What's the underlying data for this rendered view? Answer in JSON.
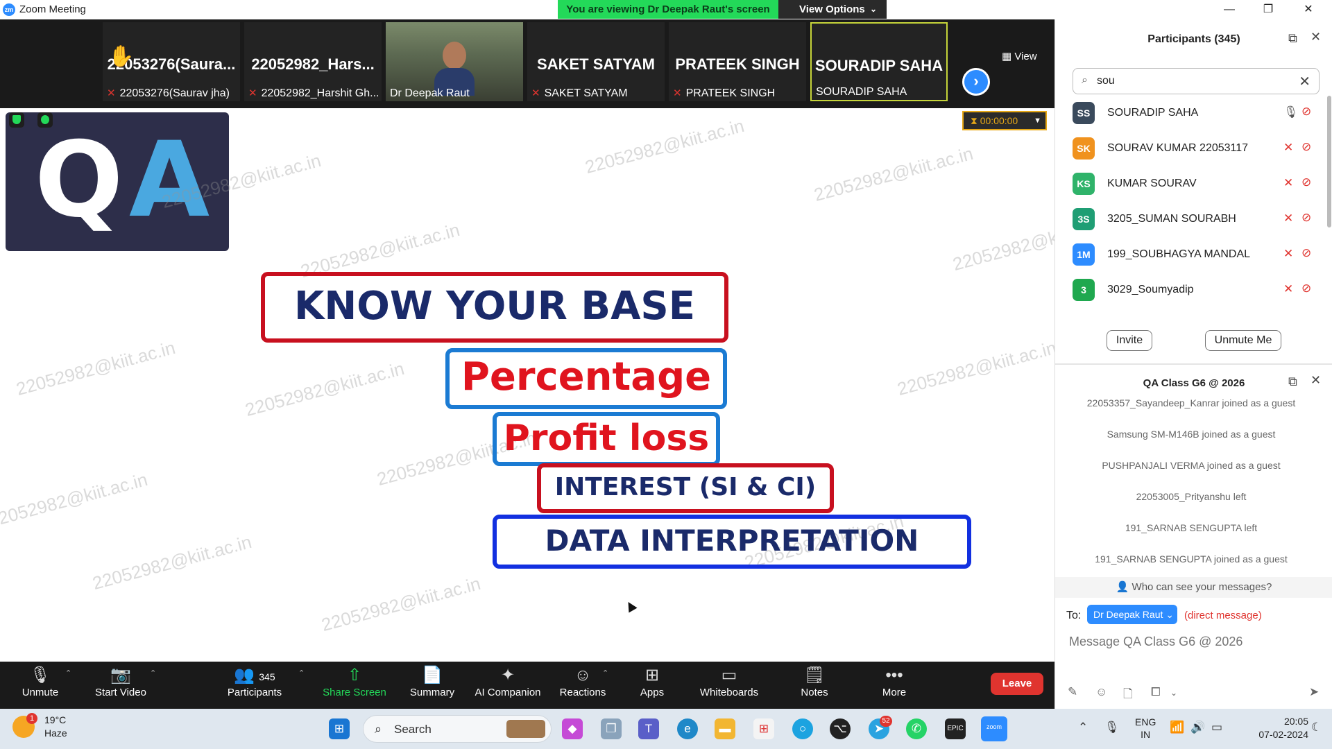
{
  "window": {
    "title": "Zoom Meeting",
    "banner_text": "You are viewing Dr Deepak Raut's screen",
    "view_options_label": "View Options",
    "minimize": "—",
    "maximize": "❐",
    "close": "✕"
  },
  "gallery": {
    "tiles": [
      {
        "big": "22053276(Saura...",
        "name": "22053276(Saurav jha)",
        "muted": true,
        "hand": true
      },
      {
        "big": "22052982_Hars...",
        "name": "22052982_Harshit Gh...",
        "muted": true
      },
      {
        "big": "",
        "name": "Dr Deepak Raut",
        "muted": false,
        "video": true
      },
      {
        "big": "SAKET SATYAM",
        "name": "SAKET SATYAM",
        "muted": true
      },
      {
        "big": "PRATEEK SINGH",
        "name": "PRATEEK SINGH",
        "muted": true
      },
      {
        "big": "SOURADIP SAHA",
        "name": "SOURADIP SAHA",
        "muted": false,
        "active": true
      }
    ],
    "view_label": "View"
  },
  "shared_screen": {
    "logo_q": "Q",
    "logo_a": "A",
    "timer": "00:00:00",
    "slide": {
      "line1": "KNOW YOUR BASE",
      "line2": "Percentage",
      "line3": "Profit loss",
      "line4": "INTEREST (SI & CI)",
      "line5": "DATA INTERPRETATION"
    },
    "watermark": "22052982@kiit.ac.in"
  },
  "toolbar": {
    "unmute": "Unmute",
    "start_video": "Start Video",
    "participants": "Participants",
    "participants_count": "345",
    "share_screen": "Share Screen",
    "summary": "Summary",
    "ai_companion": "AI Companion",
    "reactions": "Reactions",
    "apps": "Apps",
    "whiteboards": "Whiteboards",
    "notes": "Notes",
    "more": "More",
    "leave": "Leave"
  },
  "participants_panel": {
    "title": "Participants (345)",
    "search_value": "sou",
    "rows": [
      {
        "initials": "SS",
        "name": "SOURADIP SAHA",
        "color": "#3a4a5c",
        "mic_on": true
      },
      {
        "initials": "SK",
        "name": "SOURAV KUMAR 22053117",
        "color": "#f0921e",
        "mic_on": false
      },
      {
        "initials": "KS",
        "name": "KUMAR SOURAV",
        "color": "#2fb36a",
        "mic_on": false
      },
      {
        "initials": "3S",
        "name": "3205_SUMAN SOURABH",
        "color": "#1f9e74",
        "mic_on": false
      },
      {
        "initials": "1M",
        "name": "199_SOUBHAGYA MANDAL",
        "color": "#2d8cff",
        "mic_on": false
      },
      {
        "initials": "3",
        "name": "3029_Soumyadip",
        "color": "#1fa84f",
        "mic_on": false
      }
    ],
    "invite": "Invite",
    "unmute_me": "Unmute Me"
  },
  "chat_panel": {
    "title": "QA Class G6 @ 2026",
    "messages": [
      "22053357_Sayandeep_Kanrar joined as a guest",
      "Samsung SM-M146B joined as a guest",
      "PUSHPANJALI VERMA joined as a guest",
      "22053005_Prityanshu left",
      "191_SARNAB SENGUPTA left",
      "191_SARNAB SENGUPTA joined as a guest"
    ],
    "who_can_see": "Who can see your messages?",
    "to_label": "To:",
    "recipient": "Dr Deepak Raut",
    "direct": "(direct message)",
    "placeholder": "Message QA Class G6 @ 2026"
  },
  "taskbar": {
    "weather_temp": "19°C",
    "weather_cond": "Haze",
    "weather_badge": "1",
    "search": "Search",
    "telegram_badge": "52",
    "lang1": "ENG",
    "lang2": "IN",
    "time": "20:05",
    "date": "07-02-2024"
  }
}
